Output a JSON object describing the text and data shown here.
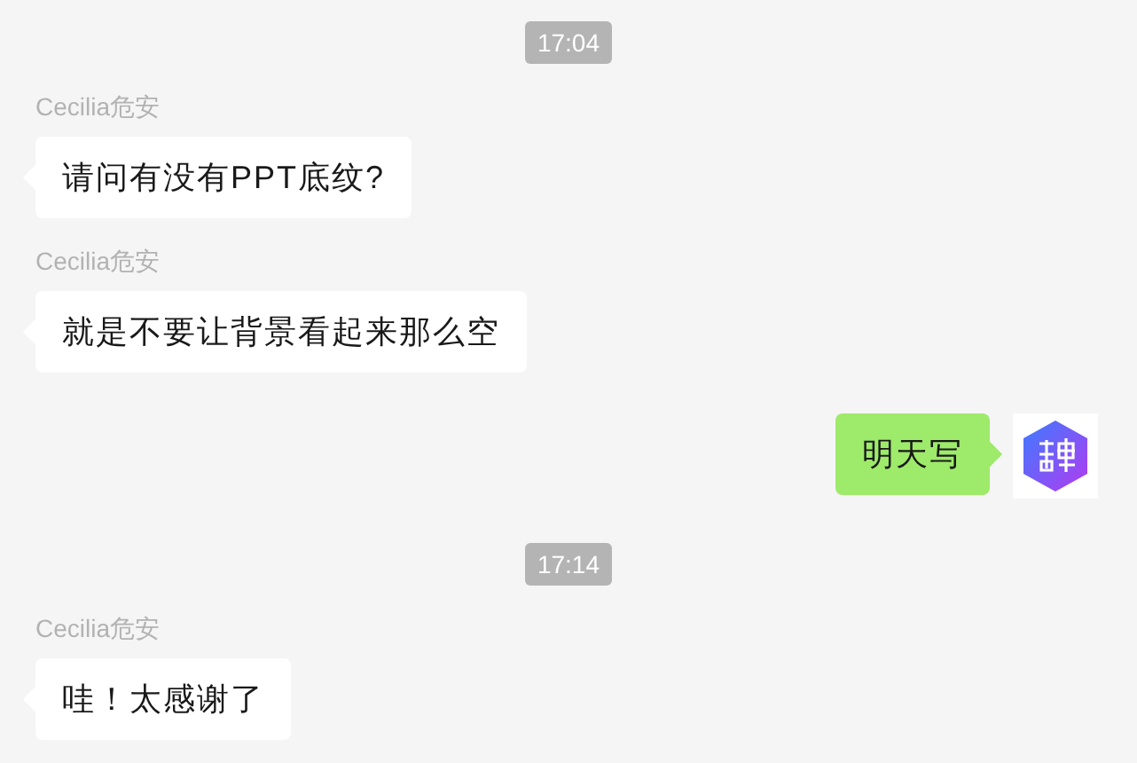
{
  "messages": [
    {
      "kind": "time",
      "text": "17:04"
    },
    {
      "kind": "incoming",
      "sender": "Cecilia危安",
      "text": "请问有没有PPT底纹?"
    },
    {
      "kind": "incoming",
      "sender": "Cecilia危安",
      "text": "就是不要让背景看起来那么空"
    },
    {
      "kind": "outgoing",
      "text": "明天写"
    },
    {
      "kind": "time",
      "text": "17:14"
    },
    {
      "kind": "incoming",
      "sender": "Cecilia危安",
      "text": "哇！太感谢了"
    }
  ]
}
